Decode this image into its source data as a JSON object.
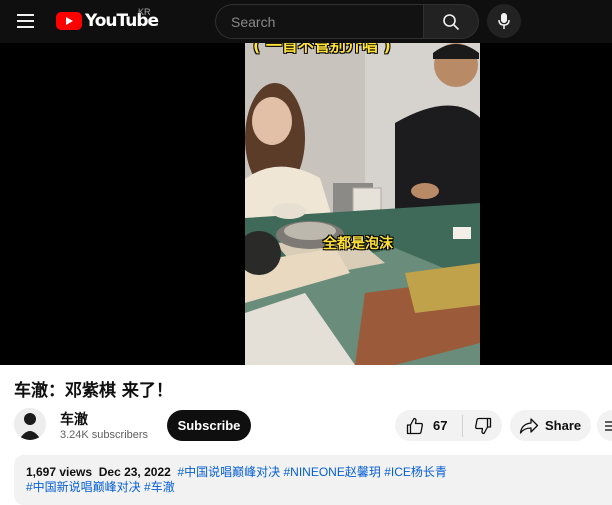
{
  "masthead": {
    "logo_text": "YouTube",
    "region": "KR",
    "search_placeholder": "Search"
  },
  "video": {
    "caption_top": "( 一首不管别介唱 )",
    "caption_mid": "全都是泡沫"
  },
  "title": "车澈：邓紫棋 来了！",
  "channel": {
    "name": "车澈",
    "subscribers": "3.24K subscribers",
    "subscribe_label": "Subscribe"
  },
  "actions": {
    "like_count": "67",
    "share_label": "Share"
  },
  "description": {
    "views": "1,697 views",
    "date": "Dec 23, 2022",
    "hashtags_line1": [
      "#中国说唱巅峰对决",
      "#NINEONE赵馨玥",
      "#ICE杨长青"
    ],
    "hashtags_line2": [
      "#中国新说唱巅峰对决",
      "#车澈"
    ]
  },
  "colors": {
    "youtube_red": "#ff0000",
    "link_blue": "#065fd4",
    "caption_yellow": "#ffe23a"
  }
}
